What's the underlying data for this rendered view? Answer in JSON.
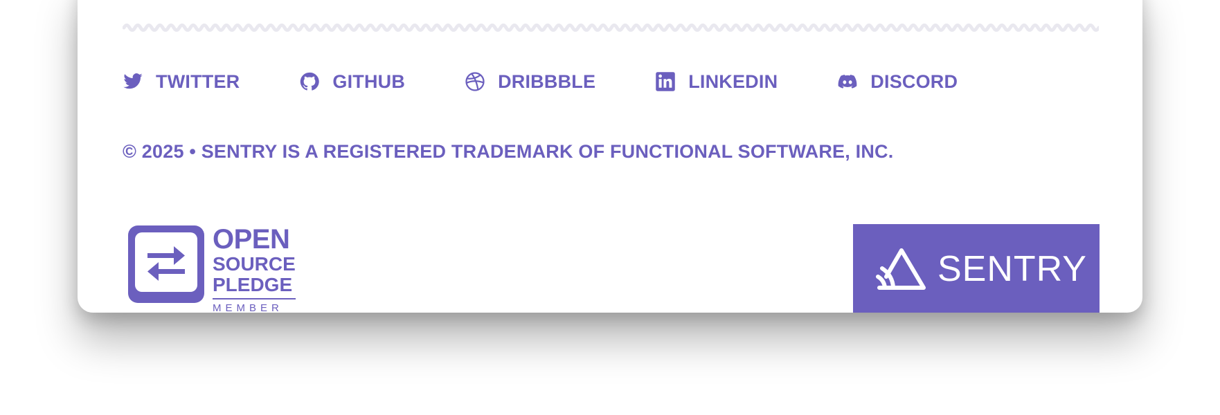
{
  "theme": {
    "accent": "#6b5fbe",
    "divider": "#e9e8ef"
  },
  "social": [
    {
      "label": "TWITTER",
      "icon": "twitter-icon"
    },
    {
      "label": "GITHUB",
      "icon": "github-icon"
    },
    {
      "label": "DRIBBBLE",
      "icon": "dribbble-icon"
    },
    {
      "label": "LINKEDIN",
      "icon": "linkedin-icon"
    },
    {
      "label": "DISCORD",
      "icon": "discord-icon"
    }
  ],
  "footer": {
    "copyright": "© 2025 • SENTRY IS A REGISTERED TRADEMARK OF FUNCTIONAL SOFTWARE, INC."
  },
  "open_source_pledge": {
    "line1": "OPEN",
    "line2": "SOURCE",
    "line3": "PLEDGE",
    "line4": "MEMBER"
  },
  "sentry_badge": {
    "word": "SENTRY"
  }
}
